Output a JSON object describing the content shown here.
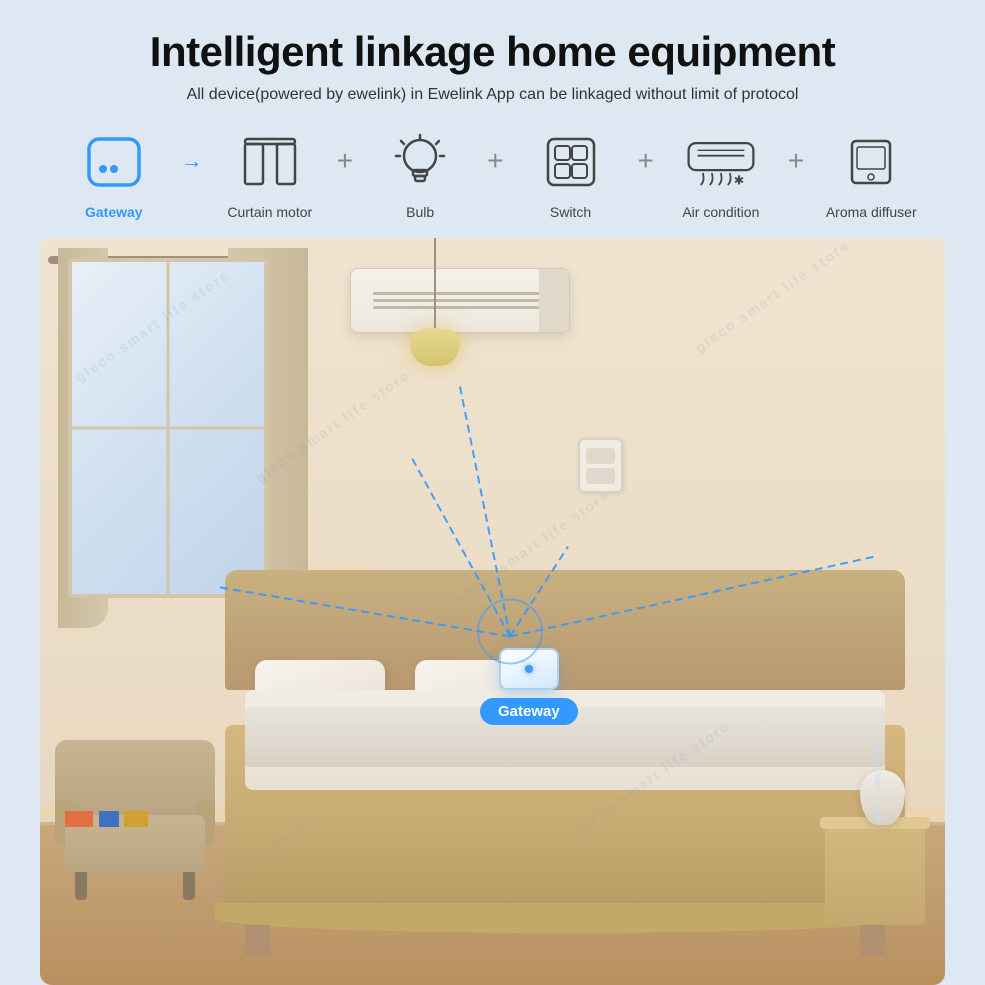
{
  "page": {
    "background_color": "#dde8f2"
  },
  "header": {
    "title": "Intelligent linkage home equipment",
    "subtitle": "All device(powered by ewelink) in Ewelink App can be linkaged without limit of protocol"
  },
  "devices": [
    {
      "id": "gateway",
      "label": "Gateway",
      "highlight": true
    },
    {
      "id": "curtain-motor",
      "label": "Curtain motor",
      "highlight": false
    },
    {
      "id": "bulb",
      "label": "Bulb",
      "highlight": false
    },
    {
      "id": "switch",
      "label": "Switch",
      "highlight": false
    },
    {
      "id": "air-condition",
      "label": "Air condition",
      "highlight": false
    },
    {
      "id": "aroma-diffuser",
      "label": "Aroma diffuser",
      "highlight": false
    }
  ],
  "scene": {
    "gateway_label": "Gateway"
  },
  "watermark": "gleco smart life store"
}
